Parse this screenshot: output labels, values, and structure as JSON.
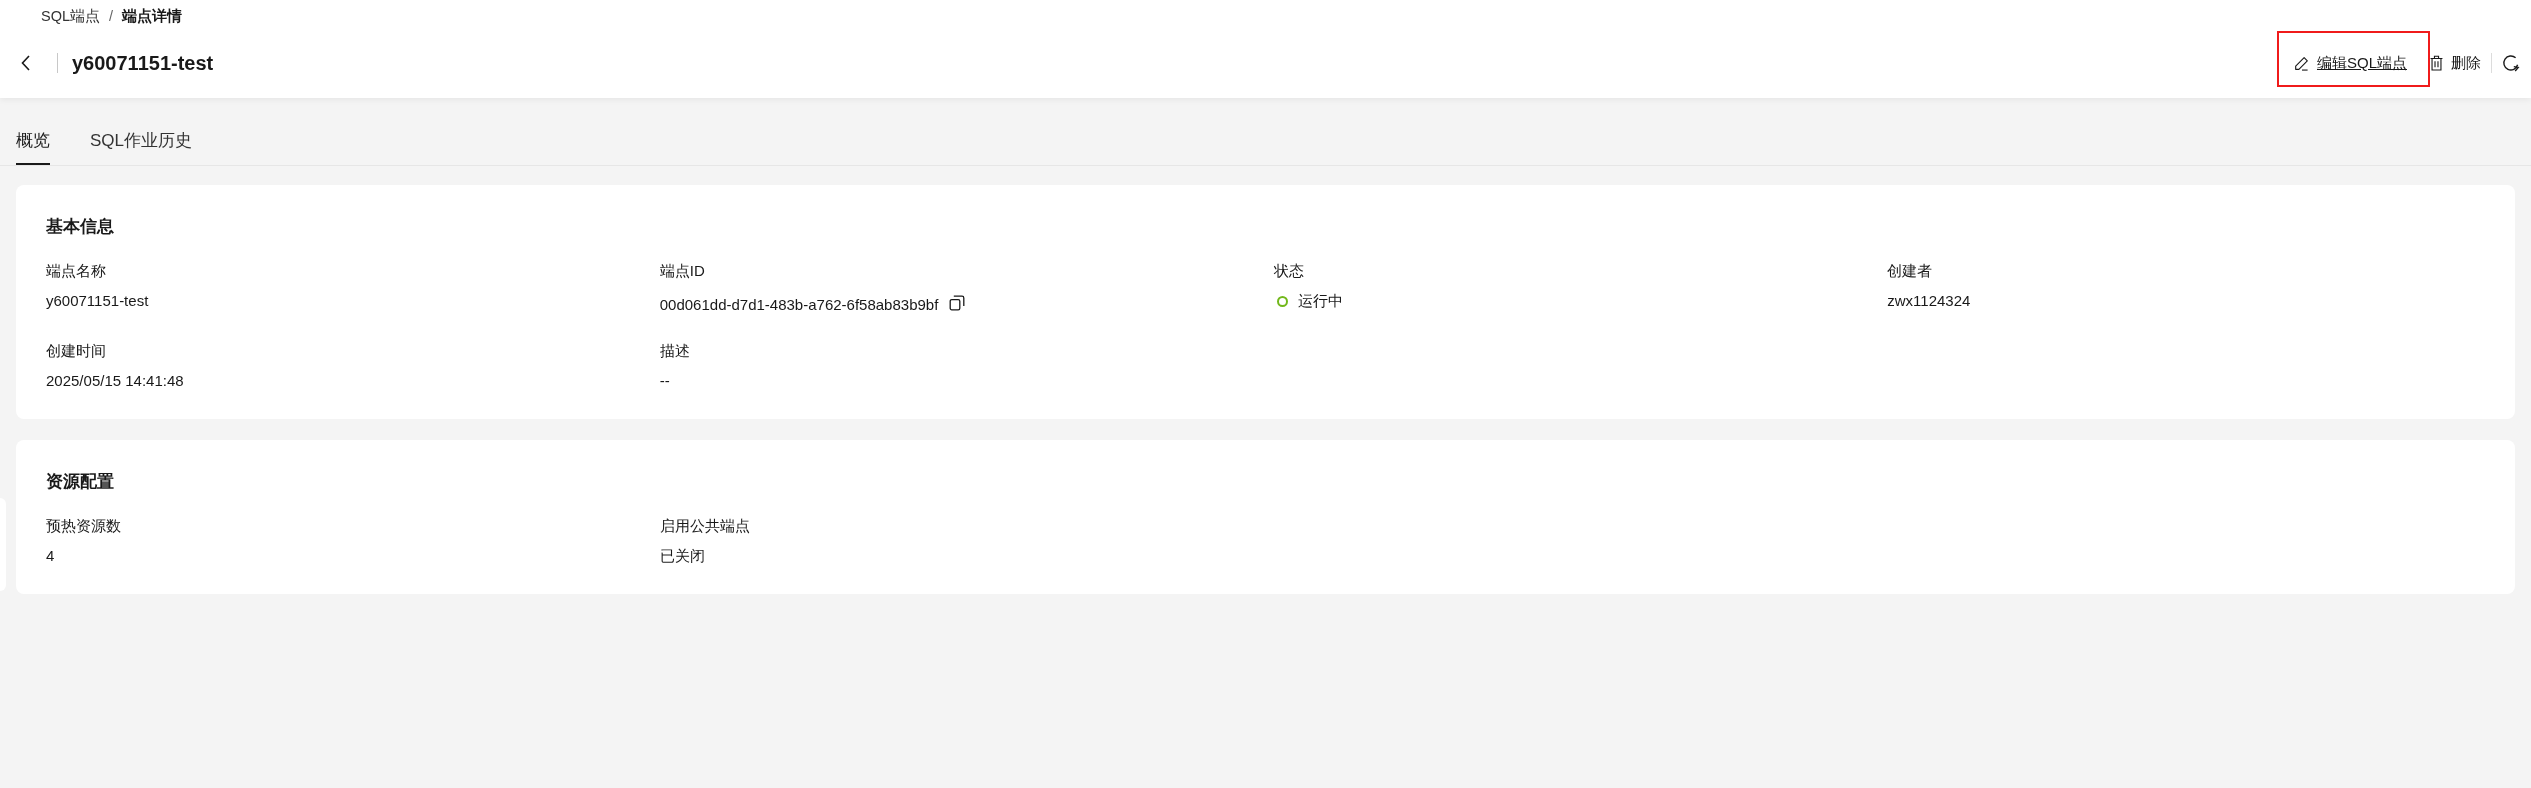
{
  "breadcrumb": {
    "items": [
      {
        "label": "SQL端点",
        "current": false
      },
      {
        "label": "端点详情",
        "current": true
      }
    ],
    "separator": "/"
  },
  "header": {
    "title": "y60071151-test",
    "actions": [
      {
        "kind": "edit",
        "label": "编辑SQL端点",
        "highlighted": true
      },
      {
        "kind": "delete",
        "label": "删除",
        "highlighted": false
      }
    ]
  },
  "tabs": [
    {
      "label": "概览",
      "selected": true
    },
    {
      "label": "SQL作业历史",
      "selected": false
    }
  ],
  "sections": [
    {
      "title": "基本信息",
      "fields": [
        {
          "kind": "text",
          "label": "端点名称",
          "value": "y60071151-test"
        },
        {
          "kind": "copyable",
          "label": "端点ID",
          "value": "00d061dd-d7d1-483b-a762-6f58ab83b9bf"
        },
        {
          "kind": "status",
          "label": "状态",
          "value": "运行中",
          "color": "#72b81b"
        },
        {
          "kind": "text",
          "label": "创建者",
          "value": "zwx1124324"
        },
        {
          "kind": "text",
          "label": "创建时间",
          "value": "2025/05/15 14:41:48"
        },
        {
          "kind": "text",
          "label": "描述",
          "value": "--"
        }
      ]
    },
    {
      "title": "资源配置",
      "fields": [
        {
          "kind": "text",
          "label": "预热资源数",
          "value": "4"
        },
        {
          "kind": "text",
          "label": "启用公共端点",
          "value": "已关闭"
        }
      ]
    }
  ]
}
